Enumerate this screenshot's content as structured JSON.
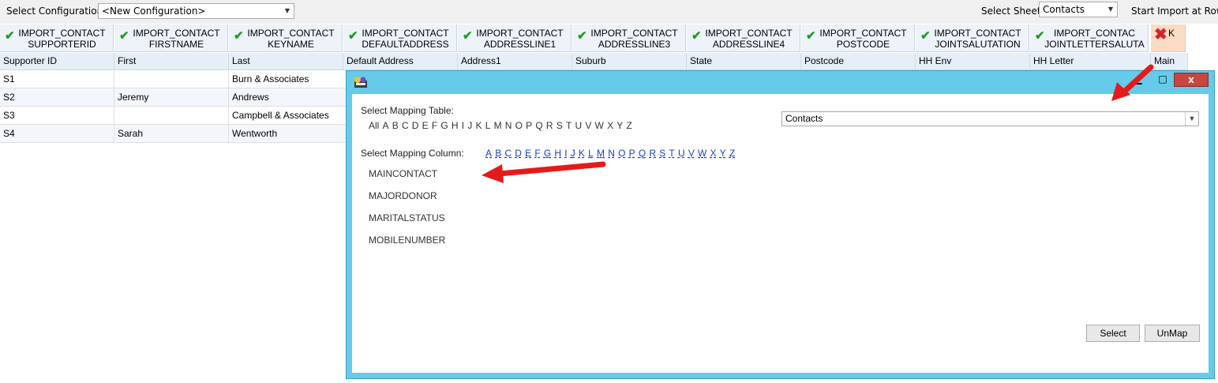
{
  "toolbar": {
    "config_label": "Select Configuration",
    "config_value": "<New Configuration>",
    "sheet_label": "Select Sheet",
    "sheet_value": "Contacts",
    "start_label": "Start Import at Row:"
  },
  "grid": {
    "mapped_headers": [
      {
        "line1": "IMPORT_CONTACT",
        "line2": "SUPPORTERID"
      },
      {
        "line1": "IMPORT_CONTACT",
        "line2": "FIRSTNAME"
      },
      {
        "line1": "IMPORT_CONTACT",
        "line2": "KEYNAME"
      },
      {
        "line1": "IMPORT_CONTACT",
        "line2": "DEFAULTADDRESS"
      },
      {
        "line1": "IMPORT_CONTACT",
        "line2": "ADDRESSLINE1"
      },
      {
        "line1": "IMPORT_CONTACT",
        "line2": "ADDRESSLINE3"
      },
      {
        "line1": "IMPORT_CONTACT",
        "line2": "ADDRESSLINE4"
      },
      {
        "line1": "IMPORT_CONTACT",
        "line2": "POSTCODE"
      },
      {
        "line1": "IMPORT_CONTACT",
        "line2": "JOINTSALUTATION"
      },
      {
        "line1": "IMPORT_CONTAC",
        "line2": "JOINTLETTERSALUTA"
      }
    ],
    "unmapped_header": "K",
    "columns": [
      "Supporter ID",
      "First",
      "Last",
      "Default Address",
      "Address1",
      "Suburb",
      "State",
      "Postcode",
      "HH Env",
      "HH Letter",
      "Main"
    ],
    "rows": [
      [
        "S1",
        "",
        "Burn & Associates"
      ],
      [
        "S2",
        "Jeremy",
        "Andrews"
      ],
      [
        "S3",
        "",
        "Campbell & Associates"
      ],
      [
        "S4",
        "Sarah",
        "Wentworth"
      ]
    ]
  },
  "dialog": {
    "minimize": "▁",
    "maximize": "□",
    "close": "x",
    "mapping_table_label": "Select Mapping Table:",
    "table_letters": [
      "All",
      "A",
      "B",
      "C",
      "D",
      "E",
      "F",
      "G",
      "H",
      "I",
      "J",
      "K",
      "L",
      "M",
      "N",
      "O",
      "P",
      "Q",
      "R",
      "S",
      "T",
      "U",
      "V",
      "W",
      "X",
      "Y",
      "Z"
    ],
    "table_value": "Contacts",
    "mapping_column_label": "Select Mapping Column:",
    "column_letters": [
      "A",
      "B",
      "C",
      "D",
      "E",
      "F",
      "G",
      "H",
      "I",
      "J",
      "K",
      "L",
      "M",
      "N",
      "O",
      "P",
      "Q",
      "R",
      "S",
      "T",
      "U",
      "V",
      "W",
      "X",
      "Y",
      "Z"
    ],
    "column_items": [
      "MAINCONTACT",
      "MAJORDONOR",
      "MARITALSTATUS",
      "MOBILENUMBER"
    ],
    "select_button": "Select",
    "unmap_button": "UnMap"
  },
  "colors": {
    "dialog_frame": "#65cbe8",
    "mapped_check": "#1e9c1e",
    "unmapped_x": "#d8222a",
    "annotation_arrow": "#e51a1a",
    "link": "#1a3fc9"
  }
}
